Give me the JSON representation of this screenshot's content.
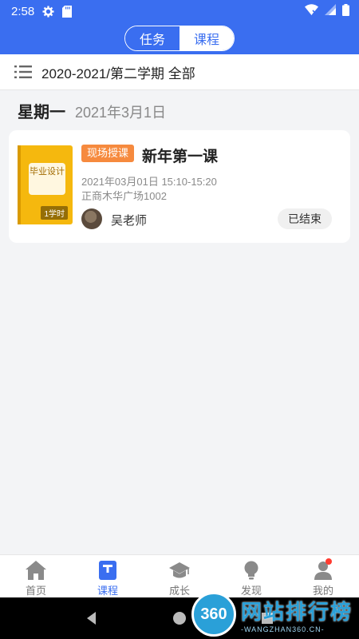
{
  "status_bar": {
    "time": "2:58"
  },
  "header": {
    "tabs": [
      {
        "label": "任务",
        "active": false
      },
      {
        "label": "课程",
        "active": true
      }
    ]
  },
  "filter": {
    "term_label": "2020-2021/第二学期 全部"
  },
  "day": {
    "weekday": "星期一",
    "date": "2021年3月1日"
  },
  "course": {
    "cover_label": "毕业设计",
    "hours_badge": "1学时",
    "tag": "现场授课",
    "title": "新年第一课",
    "time": "2021年03月01日 15:10-15:20",
    "place": "正商木华广场1002",
    "teacher": "吴老师",
    "status": "已结束"
  },
  "bottom_nav": {
    "items": [
      {
        "label": "首页",
        "icon": "home-icon",
        "active": false
      },
      {
        "label": "课程",
        "icon": "course-icon",
        "active": true
      },
      {
        "label": "成长",
        "icon": "graduation-cap-icon",
        "active": false
      },
      {
        "label": "发现",
        "icon": "lightbulb-icon",
        "active": false
      },
      {
        "label": "我的",
        "icon": "user-icon",
        "active": false,
        "badge_dot": true
      }
    ]
  },
  "watermark": {
    "number": "360",
    "title": "网站排行榜",
    "subtitle": "-WANGZHAN360.CN-"
  },
  "colors": {
    "primary": "#3a6ef0",
    "tag_orange": "#f68a3e",
    "cover_yellow": "#f5b80e"
  }
}
